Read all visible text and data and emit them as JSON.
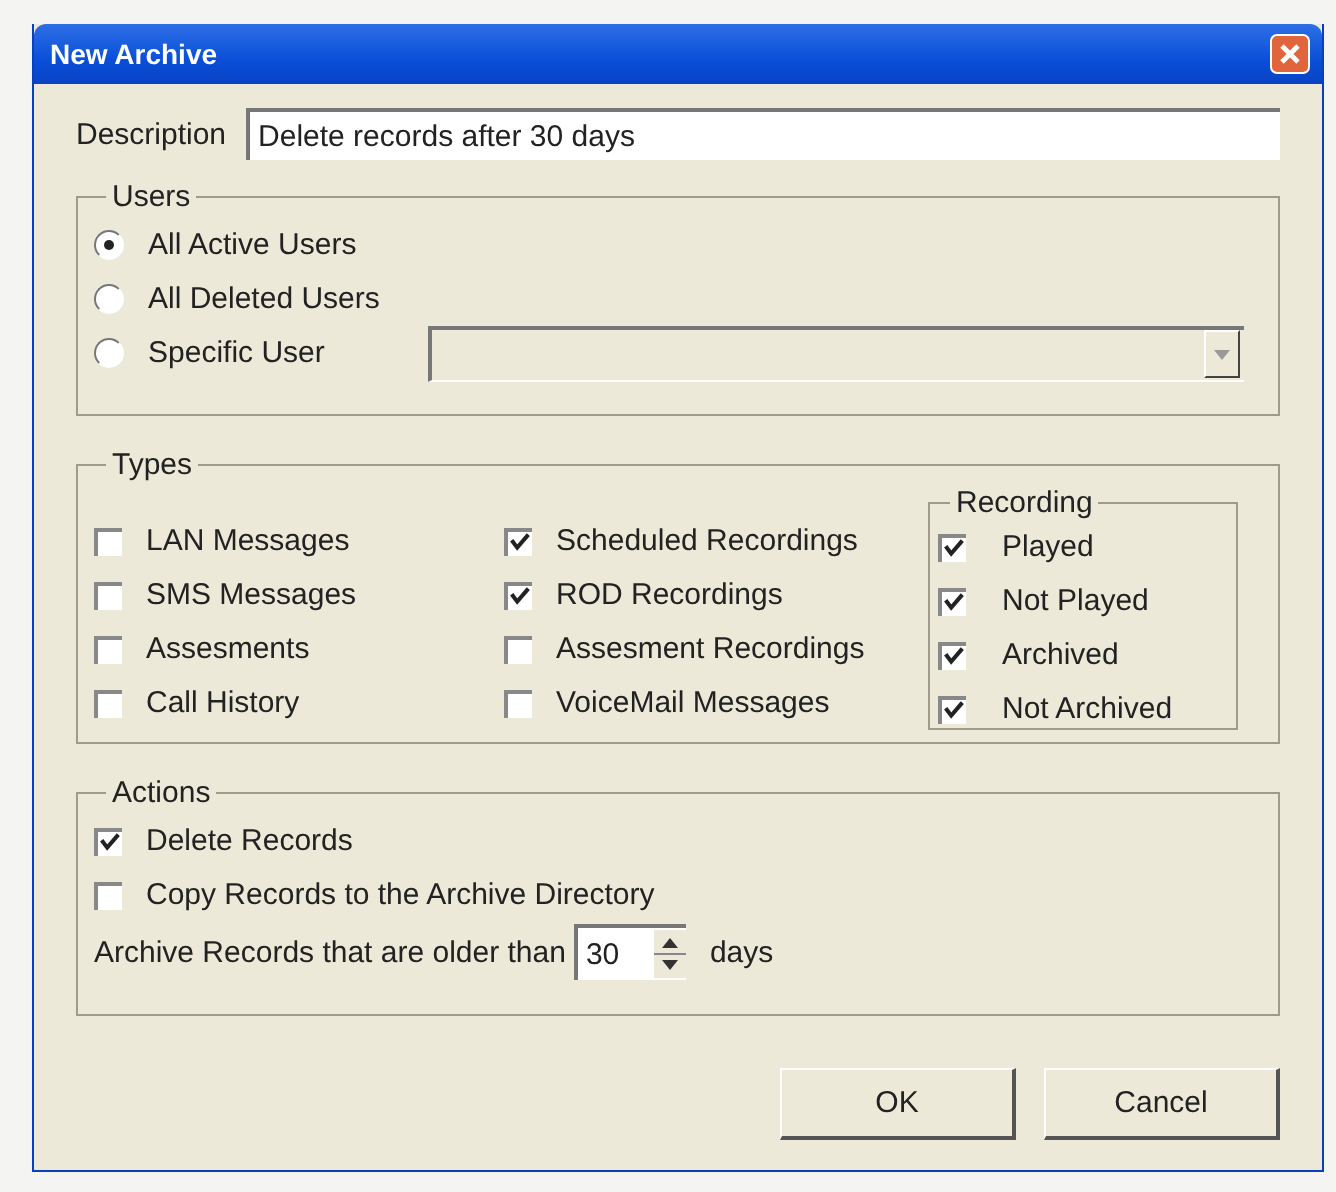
{
  "window": {
    "title": "New Archive"
  },
  "description": {
    "label": "Description",
    "value": "Delete records after 30 days"
  },
  "users": {
    "title": "Users",
    "options": [
      {
        "label": "All Active Users",
        "selected": true
      },
      {
        "label": "All Deleted Users",
        "selected": false
      },
      {
        "label": "Specific User",
        "selected": false
      }
    ]
  },
  "types": {
    "title": "Types",
    "columns": [
      [
        {
          "label": "LAN Messages",
          "checked": false
        },
        {
          "label": "SMS Messages",
          "checked": false
        },
        {
          "label": "Assesments",
          "checked": false
        },
        {
          "label": "Call History",
          "checked": false
        }
      ],
      [
        {
          "label": "Scheduled Recordings",
          "checked": true
        },
        {
          "label": "ROD Recordings",
          "checked": true
        },
        {
          "label": "Assesment Recordings",
          "checked": false
        },
        {
          "label": "VoiceMail Messages",
          "checked": false
        }
      ]
    ],
    "recording": {
      "title": "Recording",
      "items": [
        {
          "label": "Played",
          "checked": true
        },
        {
          "label": "Not Played",
          "checked": true
        },
        {
          "label": "Archived",
          "checked": true
        },
        {
          "label": "Not Archived",
          "checked": true
        }
      ]
    }
  },
  "actions": {
    "title": "Actions",
    "items": [
      {
        "label": "Delete Records",
        "checked": true
      },
      {
        "label": "Copy Records to the Archive Directory",
        "checked": false
      }
    ],
    "age_label": "Archive Records that are older than",
    "age_value": "30",
    "age_unit": "days"
  },
  "buttons": [
    "OK",
    "Cancel"
  ]
}
